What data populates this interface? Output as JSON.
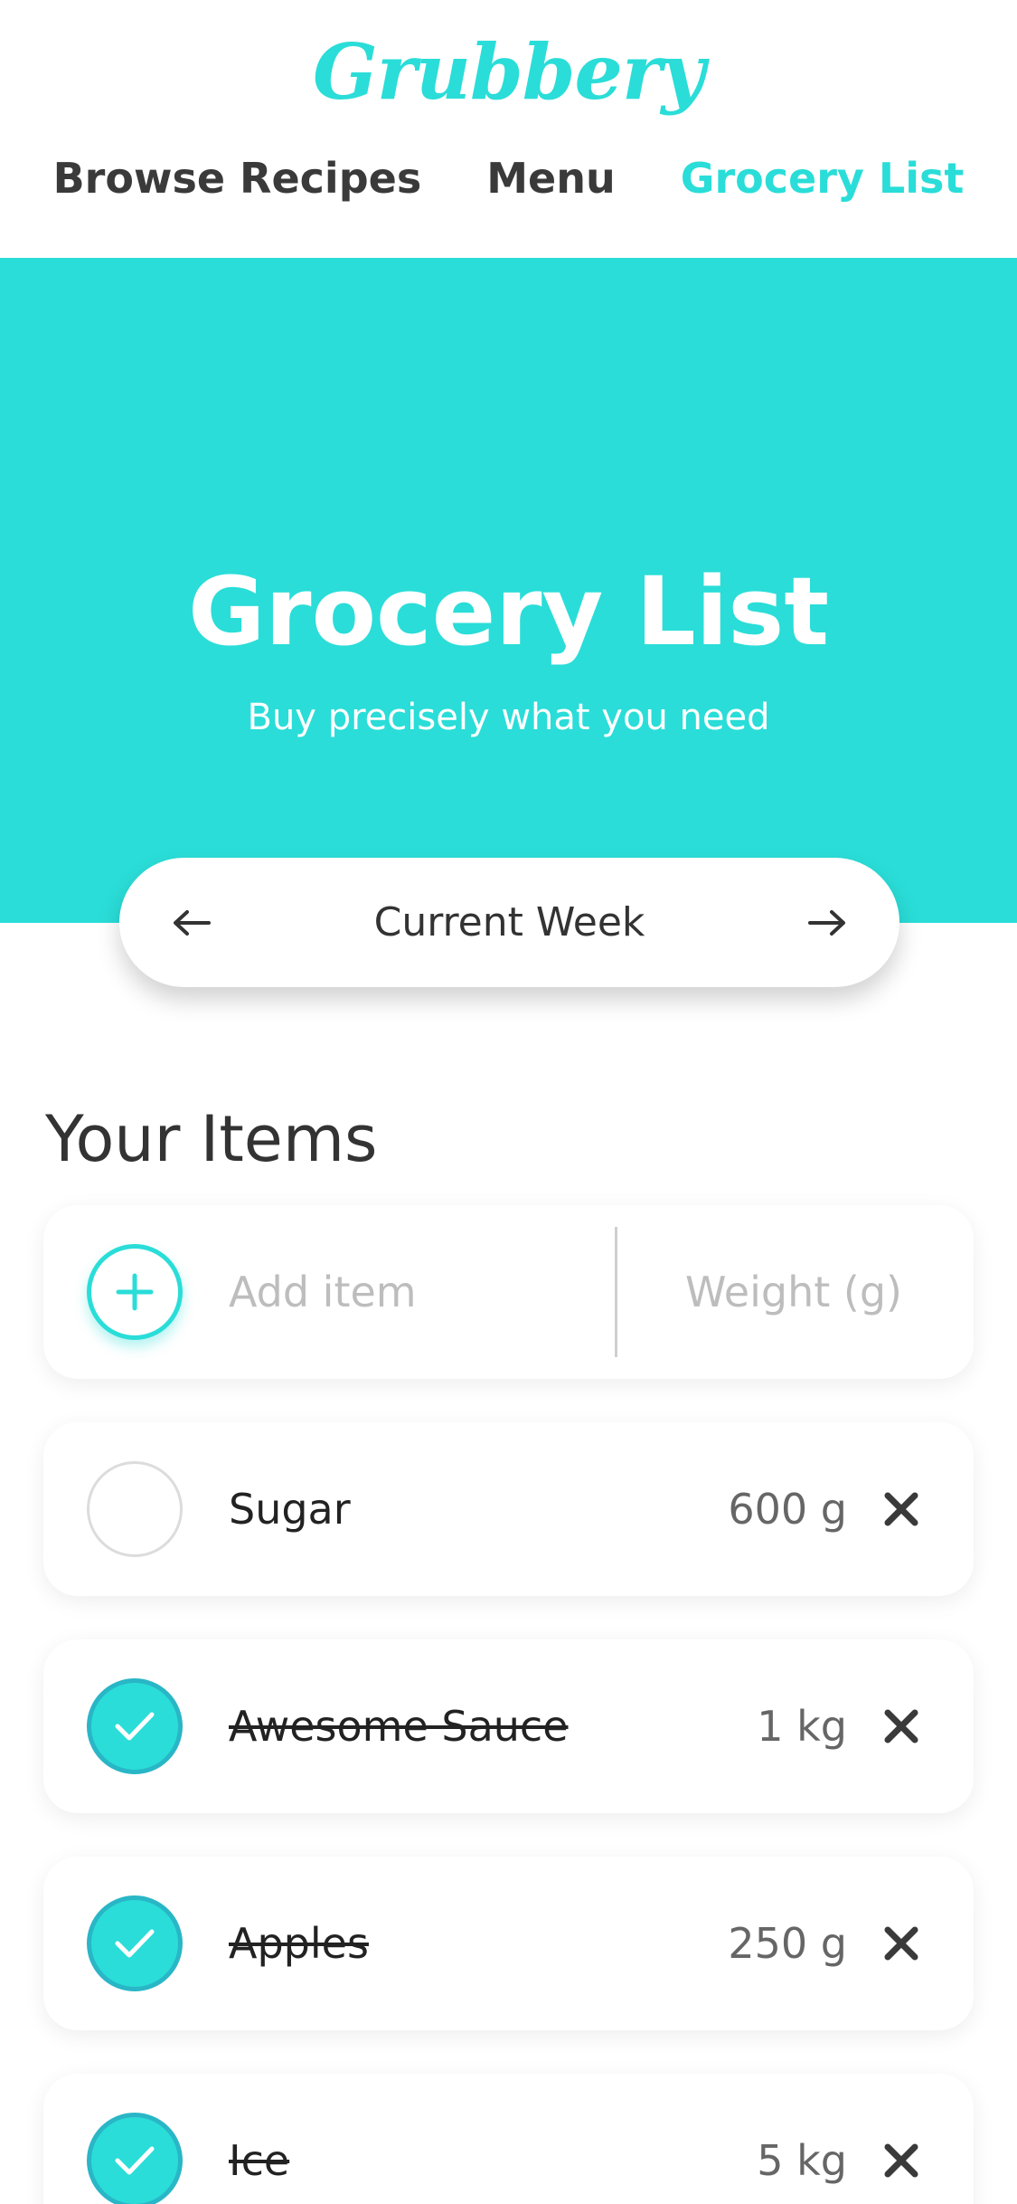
{
  "header": {
    "logo": "Grubbery",
    "nav": [
      {
        "label": "Browse Recipes",
        "active": false
      },
      {
        "label": "Menu",
        "active": false
      },
      {
        "label": "Grocery List",
        "active": true
      }
    ]
  },
  "hero": {
    "title": "Grocery List",
    "subtitle": "Buy precisely what you need"
  },
  "week_selector": {
    "label": "Current Week",
    "prev_icon": "arrow-left-icon",
    "next_icon": "arrow-right-icon"
  },
  "items_section": {
    "title": "Your Items",
    "add": {
      "item_placeholder": "Add item",
      "weight_placeholder": "Weight (g)",
      "icon": "plus-icon"
    },
    "items": [
      {
        "name": "Sugar",
        "quantity": "600 g",
        "checked": false
      },
      {
        "name": "Awesome Sauce",
        "quantity": "1 kg",
        "checked": true
      },
      {
        "name": "Apples",
        "quantity": "250 g",
        "checked": true
      },
      {
        "name": "Ice",
        "quantity": "5 kg",
        "checked": true
      }
    ]
  },
  "colors": {
    "accent": "#2ADDD8",
    "text": "#333333",
    "check_border": "#29B6C6"
  }
}
